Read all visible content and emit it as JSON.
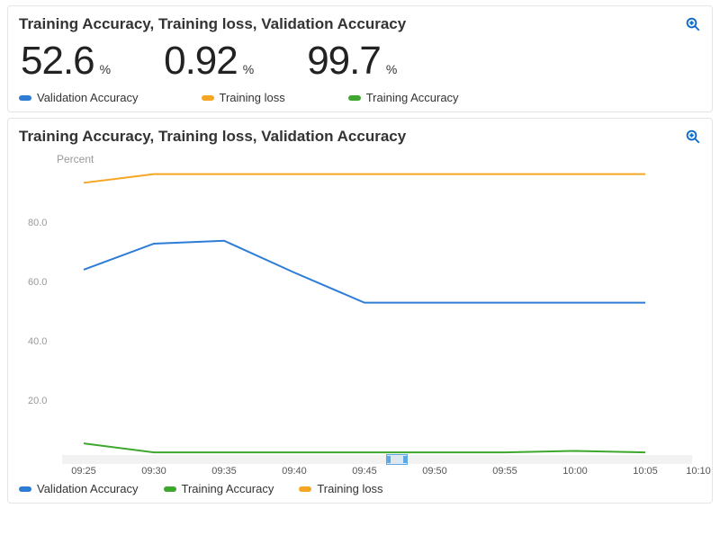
{
  "colors": {
    "validation_accuracy": "#2e7cd6",
    "training_loss": "#f5a623",
    "training_accuracy": "#3fa72f"
  },
  "summary_panel": {
    "title": "Training Accuracy, Training loss, Validation Accuracy",
    "stats": [
      {
        "value": "52.6",
        "unit": "%"
      },
      {
        "value": "0.92",
        "unit": "%"
      },
      {
        "value": "99.7",
        "unit": "%"
      }
    ],
    "legend": [
      {
        "label": "Validation Accuracy",
        "color_key": "validation_accuracy"
      },
      {
        "label": "Training loss",
        "color_key": "training_loss"
      },
      {
        "label": "Training Accuracy",
        "color_key": "training_accuracy"
      }
    ]
  },
  "chart_panel": {
    "title": "Training Accuracy, Training loss, Validation Accuracy",
    "y_axis_title": "Percent",
    "y_ticks": [
      "80.0",
      "60.0",
      "40.0",
      "20.0"
    ],
    "x_ticks": [
      "09:25",
      "09:30",
      "09:35",
      "09:40",
      "09:45",
      "09:50",
      "09:55",
      "10:00",
      "10:05",
      "10:10"
    ],
    "legend": [
      {
        "label": "Validation Accuracy",
        "color_key": "validation_accuracy"
      },
      {
        "label": "Training Accuracy",
        "color_key": "training_accuracy"
      },
      {
        "label": "Training loss",
        "color_key": "training_loss"
      }
    ]
  },
  "chart_data": {
    "type": "line",
    "xlabel": "",
    "ylabel": "Percent",
    "ylim": [
      0,
      100
    ],
    "x": [
      "09:25",
      "09:30",
      "09:35",
      "09:40",
      "09:45",
      "09:50",
      "09:55",
      "10:00",
      "10:05"
    ],
    "series": [
      {
        "name": "Training Accuracy",
        "color": "#f5a623",
        "values": [
          94,
          97,
          97,
          97,
          97,
          97,
          97,
          97,
          97
        ]
      },
      {
        "name": "Validation Accuracy",
        "color": "#2e7cd6",
        "values": [
          64,
          73,
          74,
          63,
          52.6,
          52.6,
          52.6,
          52.6,
          52.6
        ]
      },
      {
        "name": "Training loss",
        "color": "#3fa72f",
        "values": [
          4,
          0.9,
          0.9,
          0.9,
          0.9,
          0.9,
          0.9,
          1.4,
          0.9
        ]
      }
    ]
  }
}
